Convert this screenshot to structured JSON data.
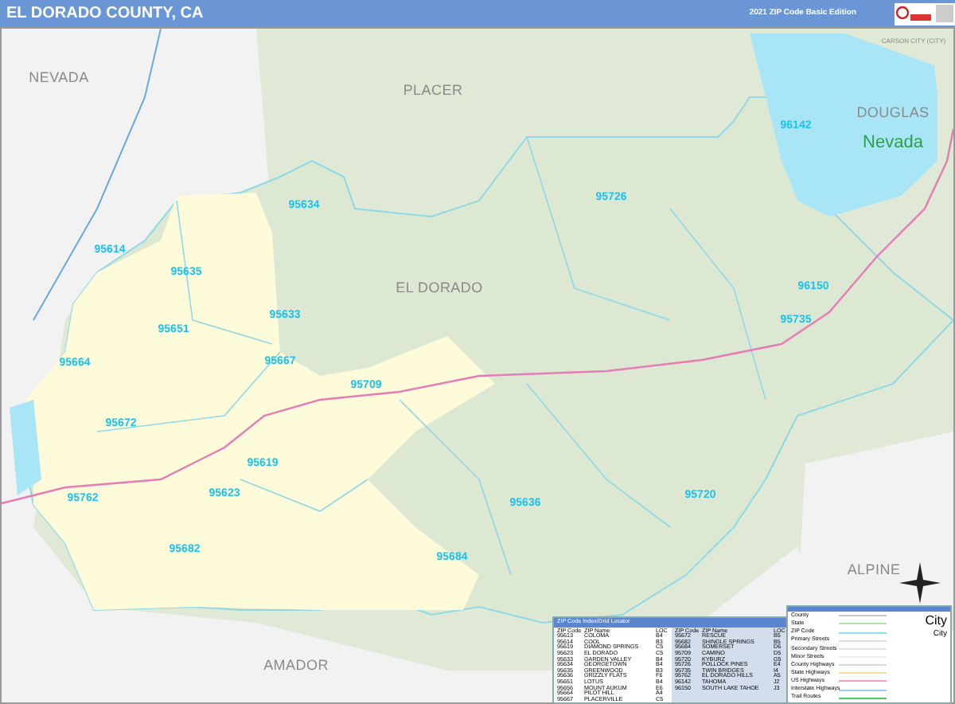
{
  "header": {
    "title": "EL DORADO COUNTY, CA",
    "edition": "2021 ZIP Code Basic Edition"
  },
  "region_labels": [
    {
      "text": "NEVADA",
      "kind": "county"
    },
    {
      "text": "PLACER",
      "kind": "county"
    },
    {
      "text": "CARSON CITY (CITY)",
      "kind": "small"
    },
    {
      "text": "DOUGLAS",
      "kind": "county"
    },
    {
      "text": "Nevada",
      "kind": "state"
    },
    {
      "text": "EL DORADO",
      "kind": "county"
    },
    {
      "text": "ALPINE",
      "kind": "county"
    },
    {
      "text": "AMADOR",
      "kind": "county"
    }
  ],
  "zip_labels": [
    "96142",
    "95726",
    "95634",
    "95614",
    "95635",
    "95633",
    "96150",
    "95651",
    "95735",
    "95664",
    "95667",
    "95709",
    "95672",
    "95619",
    "95623",
    "95762",
    "95636",
    "95720",
    "95682",
    "95684"
  ],
  "index_table": {
    "title": "ZIP Code Index/Grid Locator",
    "left_columns": [
      "ZIP Code",
      "ZIP Name",
      "LOC"
    ],
    "right_columns": [
      "ZIP Code",
      "ZIP Name",
      "LOC"
    ],
    "left_rows": [
      [
        "95613",
        "COLOMA",
        "B4"
      ],
      [
        "95614",
        "COOL",
        "B3"
      ],
      [
        "95619",
        "DIAMOND SPRINGS",
        "C5"
      ],
      [
        "95623",
        "EL DORADO",
        "C5"
      ],
      [
        "95633",
        "GARDEN VALLEY",
        "B4"
      ],
      [
        "95634",
        "GEORGETOWN",
        "B4"
      ],
      [
        "95635",
        "GREENWOOD",
        "B3"
      ],
      [
        "95636",
        "GRIZZLY FLATS",
        "F6"
      ],
      [
        "95651",
        "LOTUS",
        "B4"
      ],
      [
        "95656",
        "MOUNT AUKUM",
        "E6"
      ],
      [
        "95664",
        "PILOT HILL",
        "A4"
      ],
      [
        "95667",
        "PLACERVILLE",
        "C5"
      ]
    ],
    "right_rows": [
      [
        "95672",
        "RESCUE",
        "B5"
      ],
      [
        "95682",
        "SHINGLE SPRINGS",
        "B5"
      ],
      [
        "95684",
        "SOMERSET",
        "D6"
      ],
      [
        "95709",
        "CAMINO",
        "D5"
      ],
      [
        "95720",
        "KYBURZ",
        "G5"
      ],
      [
        "95726",
        "POLLOCK PINES",
        "E4"
      ],
      [
        "95735",
        "TWIN BRIDGES",
        "I4"
      ],
      [
        "95762",
        "EL DORADO HILLS",
        "A5"
      ],
      [
        "96142",
        "TAHOMA",
        "J2"
      ],
      [
        "96150",
        "SOUTH LAKE TAHOE",
        "J3"
      ]
    ]
  },
  "legend": {
    "items": [
      {
        "label": "County",
        "color": "#c8c8c8"
      },
      {
        "label": "State",
        "color": "#b6e3a8"
      },
      {
        "label": "ZIP Code",
        "color": "#8fe3f0"
      },
      {
        "label": "Primary Streets",
        "color": "#dddddd"
      },
      {
        "label": "Secondary Streets",
        "color": "#e6e6e6"
      },
      {
        "label": "Minor Streets",
        "color": "#eeeeee"
      },
      {
        "label": "County Highways",
        "color": "#d8d8d8"
      },
      {
        "label": "State Highways",
        "color": "#f3dca0"
      },
      {
        "label": "US Highways",
        "color": "#f59bc6"
      },
      {
        "label": "Interstate Highways",
        "color": "#9ec8f0"
      },
      {
        "label": "Trail Routes",
        "color": "#4ccf5c"
      }
    ],
    "city_samples": [
      "City",
      "City"
    ]
  }
}
